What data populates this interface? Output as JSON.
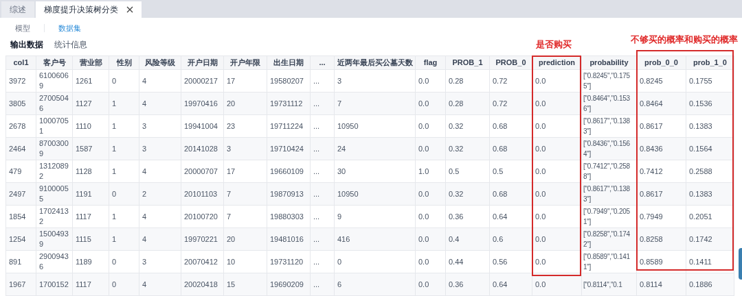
{
  "tabs": [
    {
      "label": "综述",
      "selected": false,
      "closable": false
    },
    {
      "label": "梯度提升决策树分类",
      "selected": true,
      "closable": true
    }
  ],
  "sub_tabs": [
    {
      "label": "模型",
      "selected": false
    },
    {
      "label": "数据集",
      "selected": true
    }
  ],
  "section_tabs": [
    {
      "label": "输出数据",
      "selected": true
    },
    {
      "label": "统计信息",
      "selected": false
    }
  ],
  "annotations": [
    {
      "label": "是否购买"
    },
    {
      "label": "不够买的概率和购买的概率"
    }
  ],
  "table": {
    "columns": [
      {
        "label": "col1",
        "boxed": false
      },
      {
        "label": "客户号",
        "boxed": false
      },
      {
        "label": "营业部",
        "boxed": false
      },
      {
        "label": "性别",
        "boxed": false
      },
      {
        "label": "风险等级",
        "boxed": false
      },
      {
        "label": "开户日期",
        "boxed": false
      },
      {
        "label": "开户年限",
        "boxed": false
      },
      {
        "label": "出生日期",
        "boxed": false
      },
      {
        "label": "...",
        "boxed": false
      },
      {
        "label": "近两年最后买公墓天数",
        "boxed": false
      },
      {
        "label": "flag",
        "boxed": false
      },
      {
        "label": "PROB_1",
        "boxed": false
      },
      {
        "label": "PROB_0",
        "boxed": false
      },
      {
        "label": "prediction",
        "boxed": true
      },
      {
        "label": "probability",
        "boxed": false
      },
      {
        "label": "prob_0_0",
        "boxed": true
      },
      {
        "label": "prob_1_0",
        "boxed": true
      }
    ],
    "rows": [
      [
        "3972",
        "61006069",
        "1261",
        "0",
        "4",
        "20000217",
        "17",
        "19580207",
        "...",
        "3",
        "0.0",
        "0.28",
        "0.72",
        "0.0",
        "[\"0.8245\",\"0.1755\"]",
        "0.8245",
        "0.1755"
      ],
      [
        "3805",
        "27005046",
        "1127",
        "1",
        "4",
        "19970416",
        "20",
        "19731112",
        "...",
        "7",
        "0.0",
        "0.28",
        "0.72",
        "0.0",
        "[\"0.8464\",\"0.1536\"]",
        "0.8464",
        "0.1536"
      ],
      [
        "2678",
        "10007051",
        "1110",
        "1",
        "3",
        "19941004",
        "23",
        "19711224",
        "...",
        "10950",
        "0.0",
        "0.32",
        "0.68",
        "0.0",
        "[\"0.8617\",\"0.1383\"]",
        "0.8617",
        "0.1383"
      ],
      [
        "2464",
        "87003009",
        "1587",
        "1",
        "3",
        "20141028",
        "3",
        "19710424",
        "...",
        "24",
        "0.0",
        "0.32",
        "0.68",
        "0.0",
        "[\"0.8436\",\"0.1564\"]",
        "0.8436",
        "0.1564"
      ],
      [
        "479",
        "13120892",
        "1128",
        "1",
        "4",
        "20000707",
        "17",
        "19660109",
        "...",
        "30",
        "1.0",
        "0.5",
        "0.5",
        "0.0",
        "[\"0.7412\",\"0.2588\"]",
        "0.7412",
        "0.2588"
      ],
      [
        "2497",
        "91000055",
        "1191",
        "0",
        "2",
        "20101103",
        "7",
        "19870913",
        "...",
        "10950",
        "0.0",
        "0.32",
        "0.68",
        "0.0",
        "[\"0.8617\",\"0.1383\"]",
        "0.8617",
        "0.1383"
      ],
      [
        "1854",
        "17024132",
        "1117",
        "1",
        "4",
        "20100720",
        "7",
        "19880303",
        "...",
        "9",
        "0.0",
        "0.36",
        "0.64",
        "0.0",
        "[\"0.7949\",\"0.2051\"]",
        "0.7949",
        "0.2051"
      ],
      [
        "1254",
        "15004939",
        "1115",
        "1",
        "4",
        "19970221",
        "20",
        "19481016",
        "...",
        "416",
        "0.0",
        "0.4",
        "0.6",
        "0.0",
        "[\"0.8258\",\"0.1742\"]",
        "0.8258",
        "0.1742"
      ],
      [
        "891",
        "29009436",
        "1189",
        "0",
        "3",
        "20070412",
        "10",
        "19731120",
        "...",
        "0",
        "0.0",
        "0.44",
        "0.56",
        "0.0",
        "[\"0.8589\",\"0.1411\"]",
        "0.8589",
        "0.1411"
      ],
      [
        "1967",
        "1700152",
        "1117",
        "0",
        "4",
        "20020418",
        "15",
        "19690209",
        "...",
        "6",
        "0.0",
        "0.36",
        "0.64",
        "0.0",
        "[\"0.8114\",\"0.1",
        "0.8114",
        "0.1886"
      ]
    ]
  }
}
